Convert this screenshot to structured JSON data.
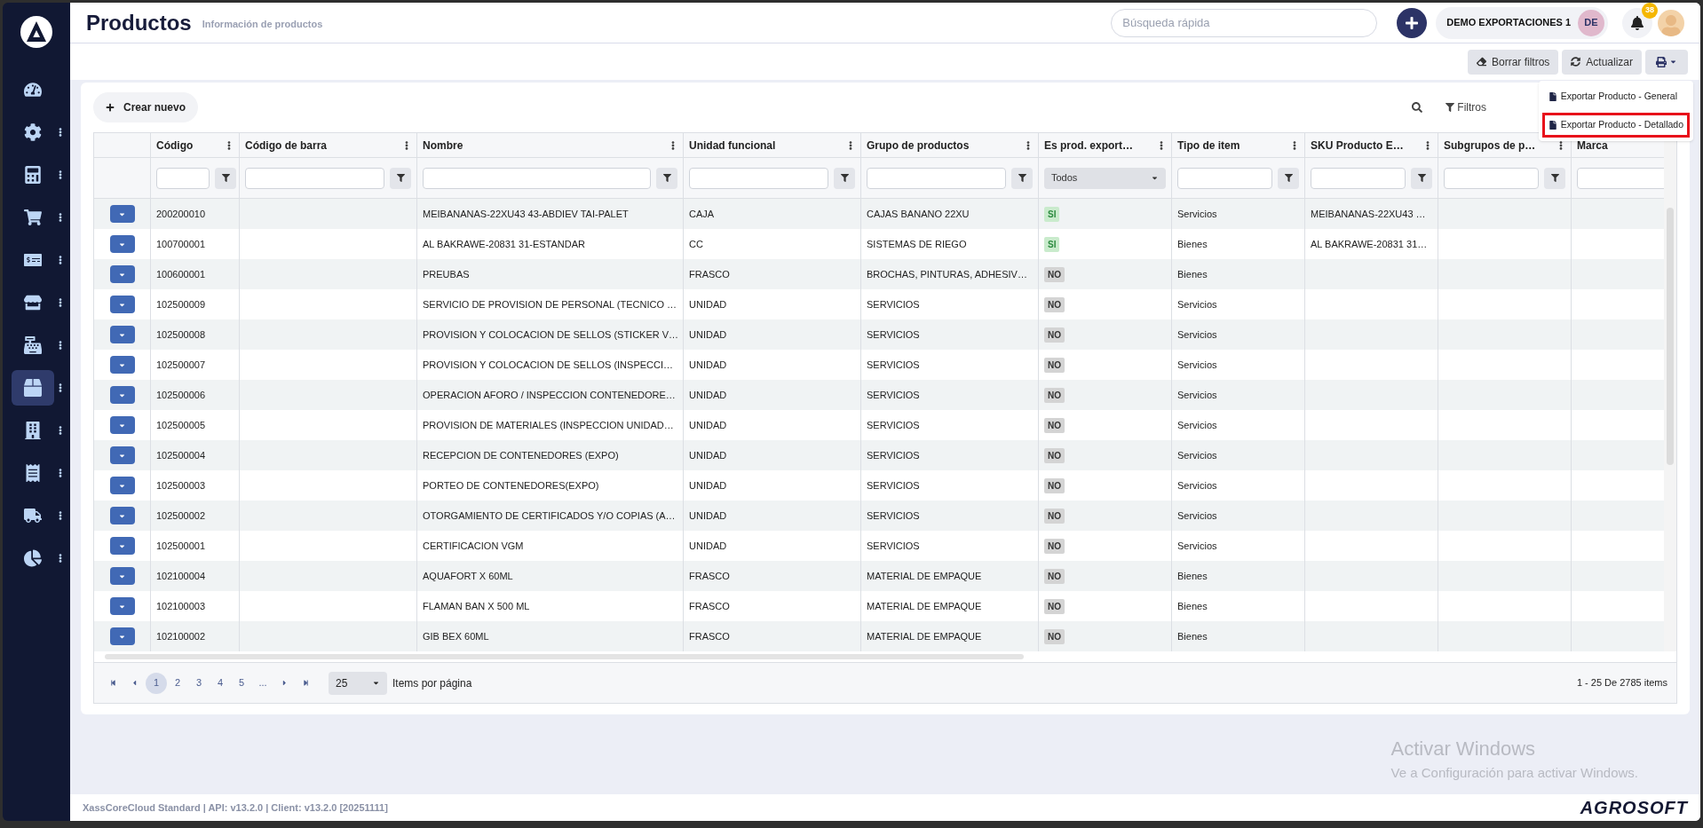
{
  "sidebar": {
    "items": [
      {
        "selected": false,
        "has_menu": false
      },
      {
        "selected": false,
        "has_menu": true
      },
      {
        "selected": false,
        "has_menu": true
      },
      {
        "selected": false,
        "has_menu": true
      },
      {
        "selected": false,
        "has_menu": true
      },
      {
        "selected": false,
        "has_menu": true
      },
      {
        "selected": false,
        "has_menu": true
      },
      {
        "selected": true,
        "has_menu": true
      },
      {
        "selected": false,
        "has_menu": true
      },
      {
        "selected": false,
        "has_menu": true
      },
      {
        "selected": false,
        "has_menu": true
      },
      {
        "selected": false,
        "has_menu": true
      }
    ]
  },
  "header": {
    "title": "Productos",
    "subtitle": "Información de productos",
    "search": {
      "placeholder": "Búsqueda rápida"
    },
    "company": "DEMO EXPORTACIONES 1",
    "company_initials": "DE",
    "notifications": "38"
  },
  "toolbar": {
    "buttons": [
      "Borrar filtros",
      "Actualizar"
    ]
  },
  "export_menu": {
    "items": [
      {
        "label": "Exportar Producto - General",
        "highlighted": false
      },
      {
        "label": "Exportar Producto - Detallado",
        "highlighted": true
      }
    ]
  },
  "card": {
    "create_button": "Crear nuevo",
    "filters_button": "Filtros"
  },
  "table": {
    "columns": [
      {
        "label": "Código",
        "menu": true,
        "filter": {
          "kind": "text"
        }
      },
      {
        "label": "Código de barra",
        "menu": true,
        "filter": {
          "kind": "text"
        }
      },
      {
        "label": "Nombre",
        "menu": true,
        "filter": {
          "kind": "text"
        }
      },
      {
        "label": "Unidad funcional",
        "menu": true,
        "filter": {
          "kind": "text"
        }
      },
      {
        "label": "Grupo de productos",
        "menu": true,
        "filter": {
          "kind": "text"
        }
      },
      {
        "label": "Es prod. export…",
        "menu": true,
        "filter": {
          "kind": "select",
          "value": "Todos"
        }
      },
      {
        "label": "Tipo de item",
        "menu": true,
        "filter": {
          "kind": "text"
        }
      },
      {
        "label": "SKU Producto E…",
        "menu": true,
        "filter": {
          "kind": "text"
        }
      },
      {
        "label": "Subgrupos de p…",
        "menu": true,
        "filter": {
          "kind": "text"
        }
      },
      {
        "label": "Marca",
        "filter": {
          "kind": "text"
        }
      }
    ],
    "rows": [
      {
        "code": "200200010",
        "name": "MEIBANANAS-22XU43 43-ABDIEV TAI-PALET",
        "unit": "CAJA",
        "group": "CAJAS BANANO 22XU",
        "export": {
          "label": "SI",
          "yes": true
        },
        "type": "Servicios",
        "sku": "MEIBANANAS-22XU43 …"
      },
      {
        "code": "100700001",
        "name": "AL BAKRAWE-20831 31-ESTANDAR",
        "unit": "CC",
        "group": "SISTEMAS DE RIEGO",
        "export": {
          "label": "SI",
          "yes": true
        },
        "type": "Bienes",
        "sku": "AL BAKRAWE-20831 31…"
      },
      {
        "code": "100600001",
        "name": "PREUBAS",
        "unit": "FRASCO",
        "group": "BROCHAS, PINTURAS, ADHESIV…",
        "export": {
          "label": "NO",
          "yes": false
        },
        "type": "Bienes"
      },
      {
        "code": "102500009",
        "name": "SERVICIO DE PROVISION DE PERSONAL (TECNICO …",
        "unit": "UNIDAD",
        "group": "SERVICIOS",
        "export": {
          "label": "NO",
          "yes": false
        },
        "type": "Servicios"
      },
      {
        "code": "102500008",
        "name": "PROVISION Y COLOCACION DE SELLOS (STICKER V…",
        "unit": "UNIDAD",
        "group": "SERVICIOS",
        "export": {
          "label": "NO",
          "yes": false
        },
        "type": "Servicios"
      },
      {
        "code": "102500007",
        "name": "PROVISION Y COLOCACION DE SELLOS (INSPECCI…",
        "unit": "UNIDAD",
        "group": "SERVICIOS",
        "export": {
          "label": "NO",
          "yes": false
        },
        "type": "Servicios"
      },
      {
        "code": "102500006",
        "name": "OPERACION AFORO / INSPECCION CONTENEDORE…",
        "unit": "UNIDAD",
        "group": "SERVICIOS",
        "export": {
          "label": "NO",
          "yes": false
        },
        "type": "Servicios"
      },
      {
        "code": "102500005",
        "name": "PROVISION DE MATERIALES (INSPECCION UNIDAD…",
        "unit": "UNIDAD",
        "group": "SERVICIOS",
        "export": {
          "label": "NO",
          "yes": false
        },
        "type": "Servicios"
      },
      {
        "code": "102500004",
        "name": "RECEPCION DE CONTENEDORES (EXPO)",
        "unit": "UNIDAD",
        "group": "SERVICIOS",
        "export": {
          "label": "NO",
          "yes": false
        },
        "type": "Servicios"
      },
      {
        "code": "102500003",
        "name": "PORTEO DE CONTENEDORES(EXPO)",
        "unit": "UNIDAD",
        "group": "SERVICIOS",
        "export": {
          "label": "NO",
          "yes": false
        },
        "type": "Servicios"
      },
      {
        "code": "102500002",
        "name": "OTORGAMIENTO DE CERTIFICADOS Y/O COPIAS (A…",
        "unit": "UNIDAD",
        "group": "SERVICIOS",
        "export": {
          "label": "NO",
          "yes": false
        },
        "type": "Servicios"
      },
      {
        "code": "102500001",
        "name": "CERTIFICACION VGM",
        "unit": "UNIDAD",
        "group": "SERVICIOS",
        "export": {
          "label": "NO",
          "yes": false
        },
        "type": "Servicios"
      },
      {
        "code": "102100004",
        "name": "AQUAFORT X 60ML",
        "unit": "FRASCO",
        "group": "MATERIAL DE EMPAQUE",
        "export": {
          "label": "NO",
          "yes": false
        },
        "type": "Bienes"
      },
      {
        "code": "102100003",
        "name": "FLAMAN BAN X 500 ML",
        "unit": "FRASCO",
        "group": "MATERIAL DE EMPAQUE",
        "export": {
          "label": "NO",
          "yes": false
        },
        "type": "Bienes"
      },
      {
        "code": "102100002",
        "name": "GIB BEX 60ML",
        "unit": "FRASCO",
        "group": "MATERIAL DE EMPAQUE",
        "export": {
          "label": "NO",
          "yes": false
        },
        "type": "Bienes"
      }
    ]
  },
  "pager": {
    "pages": [
      {
        "label": "1",
        "selected": true
      },
      {
        "label": "2",
        "selected": false
      },
      {
        "label": "3",
        "selected": false
      },
      {
        "label": "4",
        "selected": false
      },
      {
        "label": "5",
        "selected": false
      },
      {
        "label": "...",
        "selected": false
      }
    ],
    "page_size": "25",
    "page_size_label": "Items por página",
    "summary": "1 - 25 De 2785 items"
  },
  "activation_notice": {
    "title": "Activar Windows",
    "text": "Ve a Configuración para activar Windows."
  },
  "footer": {
    "version": "XassCoreCloud Standard | API: v13.2.0 | Client: v13.2.0 [20251111]",
    "brand": "AGROSOFT"
  }
}
